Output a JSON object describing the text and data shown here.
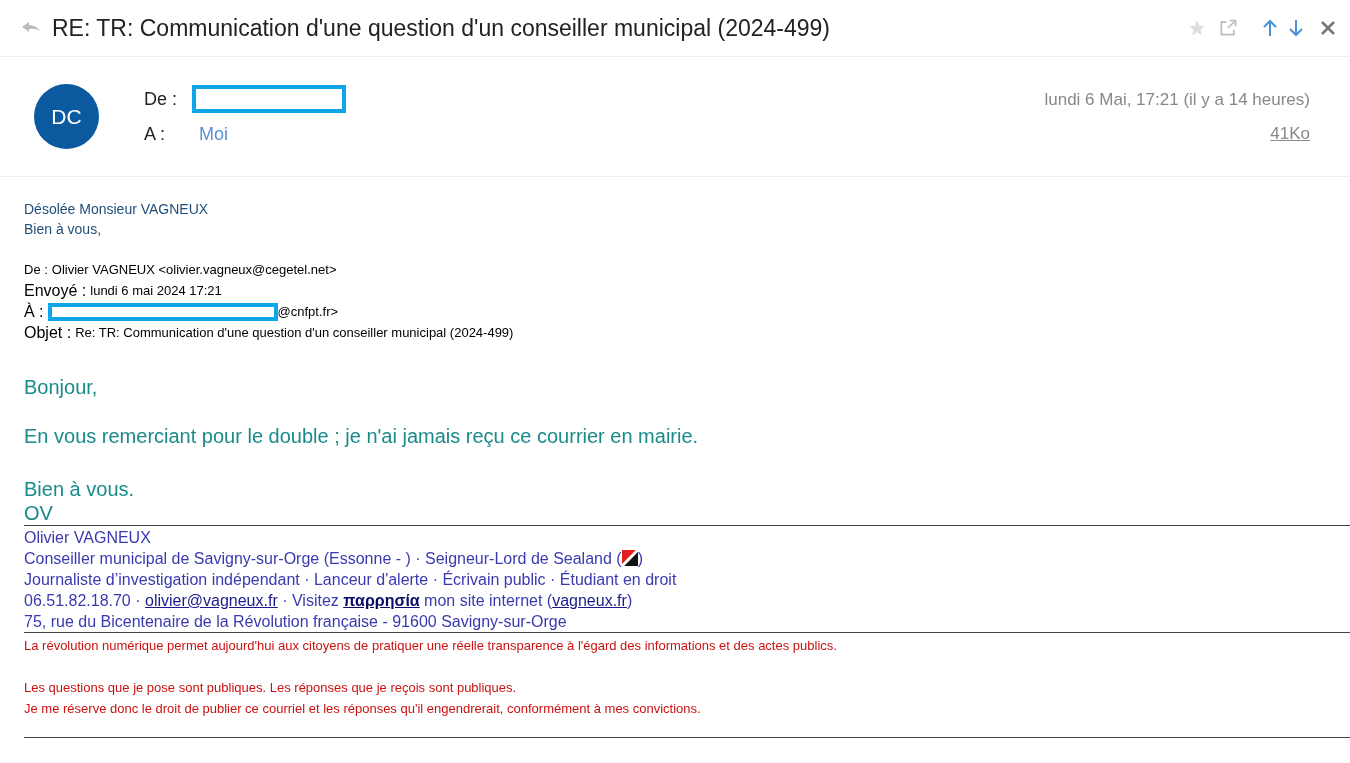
{
  "subject": "RE: TR: Communication d'une question d'un conseiller municipal (2024-499)",
  "toolbar": {
    "starred": false
  },
  "header": {
    "avatar": "DC",
    "from_label": "De :",
    "to_label": "A :",
    "to": "Moi",
    "date": "lundi 6 Mai, 17:21 (il y a 14 heures)",
    "size": "41Ko"
  },
  "reply": [
    "Désolée Monsieur VAGNEUX",
    "Bien à vous,"
  ],
  "quoted": [
    {
      "label": "De :",
      "value": "Olivier VAGNEUX <olivier.vagneux@cegetel.net>",
      "redacted": false
    },
    {
      "label": "Envoyé :",
      "value": "lundi 6 mai 2024 17:21",
      "redacted": false
    },
    {
      "label": "À :",
      "value": "@cnfpt.fr>",
      "redacted": true
    },
    {
      "label": "Objet :",
      "value": "Re: TR: Communication d'une question d'un conseiller municipal (2024-499)",
      "redacted": false
    }
  ],
  "body": [
    "Bonjour,",
    "En vous remerciant pour le double ; je n'ai jamais reçu ce courrier en mairie.",
    "Bien à vous.",
    "OV"
  ],
  "signature": [
    [
      {
        "kind": "text",
        "text": "Olivier VAGNEUX"
      }
    ],
    [
      {
        "kind": "text",
        "text": "Conseiller municipal de Savigny-sur-Orge (Essonne - ) · Seigneur-Lord de Sealand ("
      },
      {
        "kind": "flag"
      },
      {
        "kind": "text",
        "text": ")"
      }
    ],
    [
      {
        "kind": "text",
        "text": "Journaliste d’investigation indépendant · Lanceur d'alerte · Écrivain public · Étudiant en droit"
      }
    ],
    [
      {
        "kind": "text",
        "text": "06.51.82.18.70 · "
      },
      {
        "kind": "link",
        "text": "olivier@vagneux.fr"
      },
      {
        "kind": "text",
        "text": " · Visitez "
      },
      {
        "kind": "strong_link",
        "text": "παρρησία"
      },
      {
        "kind": "text",
        "text": " mon site internet ("
      },
      {
        "kind": "link",
        "text": "vagneux.fr"
      },
      {
        "kind": "text",
        "text": ")"
      }
    ],
    [
      {
        "kind": "text",
        "text": "75, rue du Bicentenaire de la Révolution française - 91600 Savigny-sur-Orge"
      }
    ]
  ],
  "disclaimer": [
    [
      "La révolution numérique permet aujourd'hui aux citoyens de pratiquer une réelle transparence à l'égard des informations et des actes publics."
    ],
    [
      "Les questions que je pose sont publiques. Les réponses que je reçois sont publiques.",
      "Je me réserve donc le droit de publier ce courriel et les réponses qu'il engendrerait, conformément à mes convictions."
    ]
  ]
}
